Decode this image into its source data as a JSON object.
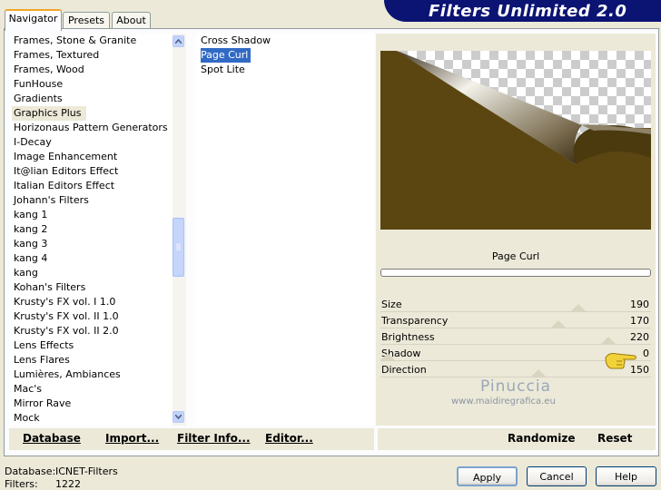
{
  "banner": {
    "title": "Filters Unlimited 2.0"
  },
  "tabs": [
    {
      "label": "Navigator",
      "active": true
    },
    {
      "label": "Presets",
      "active": false
    },
    {
      "label": "About",
      "active": false
    }
  ],
  "categories": [
    "Frames, Stone & Granite",
    "Frames, Textured",
    "Frames, Wood",
    "FunHouse",
    "Gradients",
    "Graphics Plus",
    "Horizonaus Pattern Generators",
    "I-Decay",
    "Image Enhancement",
    "It@lian Editors Effect",
    "Italian Editors Effect",
    "Johann's Filters",
    "kang 1",
    "kang 2",
    "kang 3",
    "kang 4",
    "kang",
    "Kohan's Filters",
    "Krusty's FX vol. I 1.0",
    "Krusty's FX vol. II 1.0",
    "Krusty's FX vol. II 2.0",
    "Lens Effects",
    "Lens Flares",
    "Lumières, Ambiances",
    "Mac's",
    "Mirror Rave",
    "Mock"
  ],
  "selected_category": "Graphics Plus",
  "filters": [
    "Cross Shadow",
    "Page Curl",
    "Spot Lite"
  ],
  "selected_filter": "Page Curl",
  "preview": {
    "filter_name": "Page Curl"
  },
  "params": [
    {
      "label": "Size",
      "value": "190"
    },
    {
      "label": "Transparency",
      "value": "170"
    },
    {
      "label": "Brightness",
      "value": "220"
    },
    {
      "label": "Shadow",
      "value": "0"
    },
    {
      "label": "Direction",
      "value": "150"
    }
  ],
  "watermark": {
    "name": "Pinuccia",
    "url": "www.maidiregrafica.eu"
  },
  "left_buttons": {
    "database": "Database",
    "import": "Import...",
    "filter_info": "Filter Info...",
    "editor": "Editor..."
  },
  "right_buttons": {
    "randomize": "Randomize",
    "reset": "Reset"
  },
  "status": {
    "database_label": "Database:",
    "database_value": "ICNET-Filters",
    "filters_label": "Filters:",
    "filters_value": "1222"
  },
  "dialog_buttons": {
    "apply": "Apply",
    "cancel": "Cancel",
    "help": "Help"
  },
  "colors": {
    "banner_bg": "#0b1373",
    "selection": "#316ac5",
    "preview_brown": "#5b4611"
  }
}
